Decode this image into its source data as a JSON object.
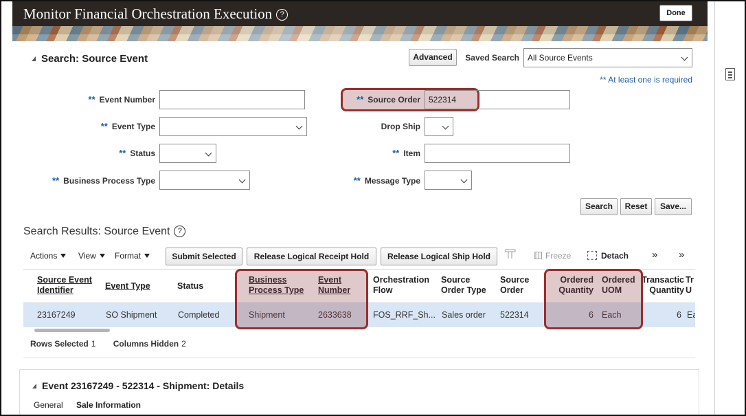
{
  "header": {
    "title": "Monitor Financial Orchestration Execution",
    "help_glyph": "?",
    "done_label": "Done"
  },
  "search": {
    "title": "Search: Source Event",
    "advanced_label": "Advanced",
    "saved_search_label": "Saved Search",
    "saved_search_value": "All Source Events",
    "required_hint": "** At least one is required",
    "required_marker": "**",
    "fields": {
      "event_number": {
        "label": "Event Number",
        "value": ""
      },
      "event_type": {
        "label": "Event Type",
        "value": ""
      },
      "status": {
        "label": "Status",
        "value": ""
      },
      "business_process_type": {
        "label": "Business Process Type",
        "value": ""
      },
      "source_order": {
        "label": "Source Order",
        "value": "522314"
      },
      "drop_ship": {
        "label": "Drop Ship",
        "value": ""
      },
      "item": {
        "label": "Item",
        "value": ""
      },
      "message_type": {
        "label": "Message Type",
        "value": ""
      }
    },
    "buttons": {
      "search": "Search",
      "reset": "Reset",
      "save": "Save..."
    }
  },
  "results": {
    "title": "Search Results: Source Event",
    "toolbar": {
      "actions": "Actions",
      "view": "View",
      "format": "Format",
      "submit_selected": "Submit Selected",
      "release_logical_receipt_hold": "Release Logical Receipt Hold",
      "release_logical_ship_hold": "Release Logical Ship Hold",
      "freeze": "Freeze",
      "detach": "Detach",
      "scroll_more": "»",
      "scroll_end": "»"
    },
    "columns": [
      [
        "Source Event",
        "Identifier"
      ],
      [
        "Event Type"
      ],
      [
        "Status"
      ],
      [
        "Business",
        "Process Type"
      ],
      [
        "Event",
        "Number"
      ],
      [
        "Orchestration",
        "Flow"
      ],
      [
        "Source",
        "Order Type"
      ],
      [
        "Source",
        "Order"
      ],
      [
        "Ordered",
        "Quantity"
      ],
      [
        "Ordered",
        "UOM"
      ],
      [
        "Transactic",
        "Quantity"
      ],
      [
        "Tr",
        "U"
      ]
    ],
    "rows": [
      [
        "23167249",
        "SO Shipment",
        "Completed",
        "Shipment",
        "2633638",
        "FOS_RRF_Sh...",
        "Sales order",
        "522314",
        "6",
        "Each",
        "6",
        "Ea"
      ]
    ],
    "footer": {
      "rows_selected_label": "Rows Selected",
      "rows_selected_value": "1",
      "columns_hidden_label": "Columns Hidden",
      "columns_hidden_value": "2"
    }
  },
  "details": {
    "title": "Event 23167249 - 522314 - Shipment: Details",
    "tabs": [
      "General",
      "Sale Information"
    ]
  },
  "colors": {
    "header_bg": "#2b2622",
    "required_blue": "#1e5aa8",
    "highlight": "#9b2d2d",
    "selected_row": "#d9e6f5"
  },
  "icons": [
    "help-icon",
    "collapse-triangle-icon",
    "chevron-down-icon",
    "document-icon",
    "freeze-icon",
    "detach-icon",
    "double-chevron-right-icon",
    "column-icon"
  ]
}
